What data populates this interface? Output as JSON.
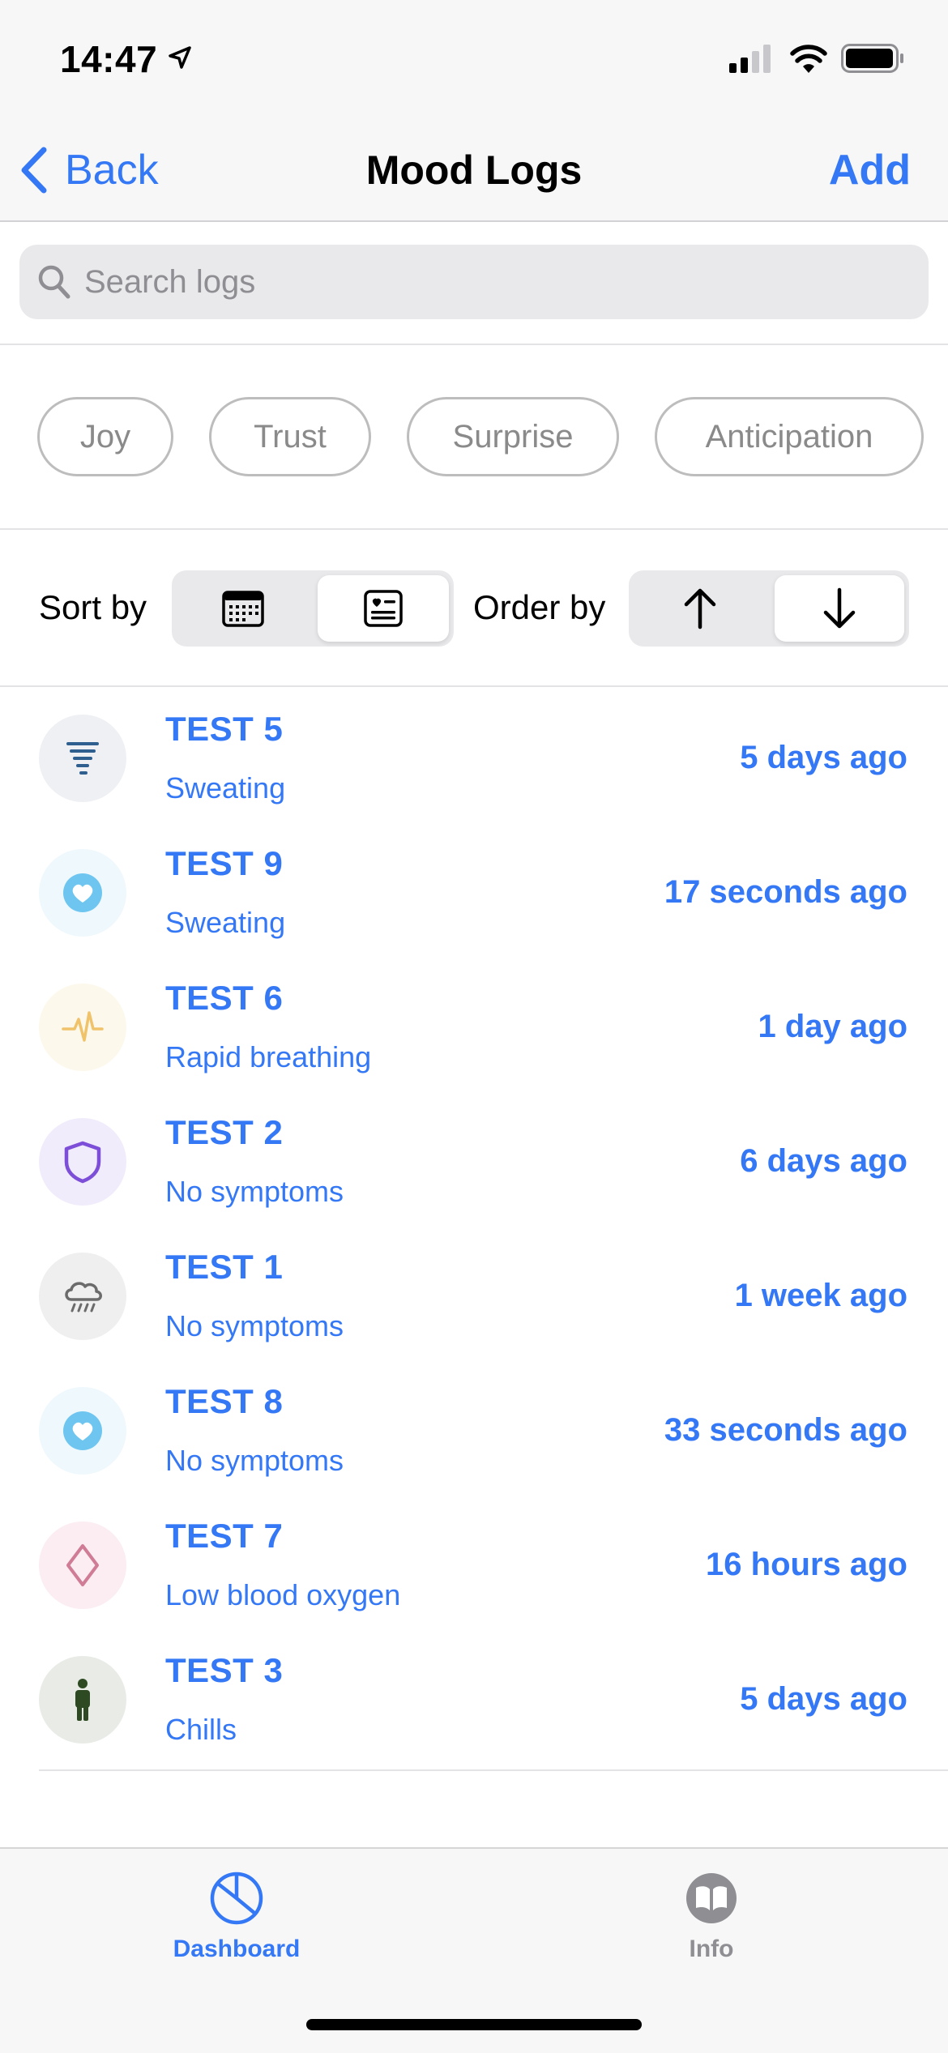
{
  "status_bar": {
    "time": "14:47"
  },
  "nav": {
    "back_label": "Back",
    "title": "Mood Logs",
    "add_label": "Add"
  },
  "search": {
    "placeholder": "Search logs"
  },
  "filters": {
    "chips": [
      "Joy",
      "Trust",
      "Surprise",
      "Anticipation"
    ]
  },
  "sort": {
    "sort_label": "Sort by",
    "order_label": "Order by",
    "sort_selected": "text",
    "order_selected": "descending"
  },
  "logs": [
    {
      "title": "TEST 5",
      "subtitle": "Sweating",
      "time": "5 days ago",
      "icon": "tornado-icon",
      "icon_color": "#2f5f8f",
      "bg": "#eef0f3"
    },
    {
      "title": "TEST 9",
      "subtitle": "Sweating",
      "time": "17 seconds ago",
      "icon": "heart-icon",
      "icon_color": "#6ec6f0",
      "bg": "#eef8fd"
    },
    {
      "title": "TEST 6",
      "subtitle": "Rapid breathing",
      "time": "1 day ago",
      "icon": "waveform-icon",
      "icon_color": "#f0c36b",
      "bg": "#fdf8ec"
    },
    {
      "title": "TEST 2",
      "subtitle": "No symptoms",
      "time": "6 days ago",
      "icon": "shield-icon",
      "icon_color": "#7d4fd8",
      "bg": "#f1ecfb"
    },
    {
      "title": "TEST 1",
      "subtitle": "No symptoms",
      "time": "1 week ago",
      "icon": "cloud-rain-icon",
      "icon_color": "#6b6b6b",
      "bg": "#efefef"
    },
    {
      "title": "TEST 8",
      "subtitle": "No symptoms",
      "time": "33 seconds ago",
      "icon": "heart-icon",
      "icon_color": "#6ec6f0",
      "bg": "#eef8fd"
    },
    {
      "title": "TEST 7",
      "subtitle": "Low blood oxygen",
      "time": "16 hours ago",
      "icon": "diamond-icon",
      "icon_color": "#d07c96",
      "bg": "#fbedf1"
    },
    {
      "title": "TEST 3",
      "subtitle": "Chills",
      "time": "5 days ago",
      "icon": "person-icon",
      "icon_color": "#2e4a22",
      "bg": "#e8ebe6"
    }
  ],
  "tabbar": {
    "tabs": [
      {
        "label": "Dashboard",
        "active": true
      },
      {
        "label": "Info",
        "active": false
      }
    ],
    "active_color": "#3478f6",
    "inactive_color": "#8e8e93"
  },
  "colors": {
    "accent": "#3478f6"
  }
}
